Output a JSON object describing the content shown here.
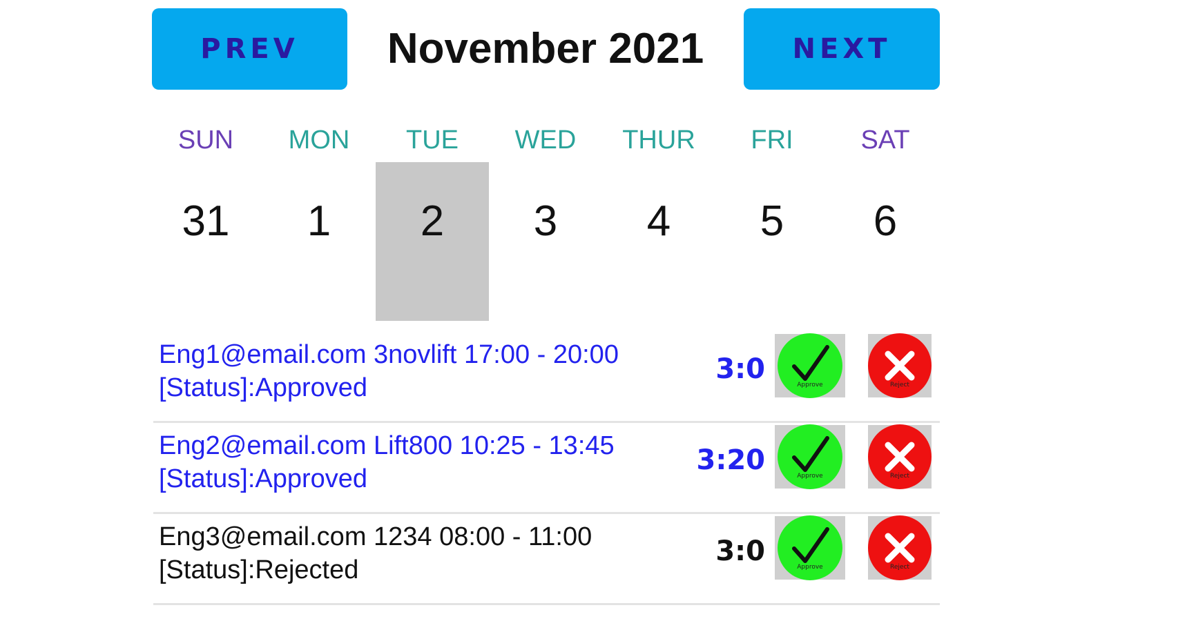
{
  "header": {
    "prev_label": "PREV",
    "next_label": "NEXT",
    "month_title": "November 2021"
  },
  "weekdays": [
    {
      "label": "SUN",
      "color": "#6a3fb5"
    },
    {
      "label": "MON",
      "color": "#2aa39a"
    },
    {
      "label": "TUE",
      "color": "#2aa39a"
    },
    {
      "label": "WED",
      "color": "#2aa39a"
    },
    {
      "label": "THUR",
      "color": "#2aa39a"
    },
    {
      "label": "FRI",
      "color": "#2aa39a"
    },
    {
      "label": "SAT",
      "color": "#6a3fb5"
    }
  ],
  "days": [
    {
      "label": "31",
      "selected": false
    },
    {
      "label": "1",
      "selected": false
    },
    {
      "label": "2",
      "selected": true
    },
    {
      "label": "3",
      "selected": false
    },
    {
      "label": "4",
      "selected": false
    },
    {
      "label": "5",
      "selected": false
    },
    {
      "label": "6",
      "selected": false
    }
  ],
  "events": [
    {
      "line1": "Eng1@email.com 3novlift 17:00 - 20:00",
      "line2": "[Status]:Approved",
      "duration": "3:0",
      "color": "#2222ee",
      "approve_caption": "Approve",
      "reject_caption": "Reject"
    },
    {
      "line1": "Eng2@email.com Lift800 10:25 - 13:45",
      "line2": "[Status]:Approved",
      "duration": "3:20",
      "color": "#2222ee",
      "approve_caption": "Approve",
      "reject_caption": "Reject"
    },
    {
      "line1": "Eng3@email.com 1234 08:00 - 11:00",
      "line2": "[Status]:Rejected",
      "duration": "3:0",
      "color": "#111111",
      "approve_caption": "Approve",
      "reject_caption": "Reject"
    }
  ],
  "icons": {
    "approve": "checkmark-icon",
    "reject": "x-icon"
  },
  "colors": {
    "nav_button_bg": "#05a8ee",
    "nav_button_text": "#2a1aa0",
    "selected_day_bg": "#c8c8c8",
    "approve_green": "#22ee22",
    "reject_red": "#ee1111"
  }
}
